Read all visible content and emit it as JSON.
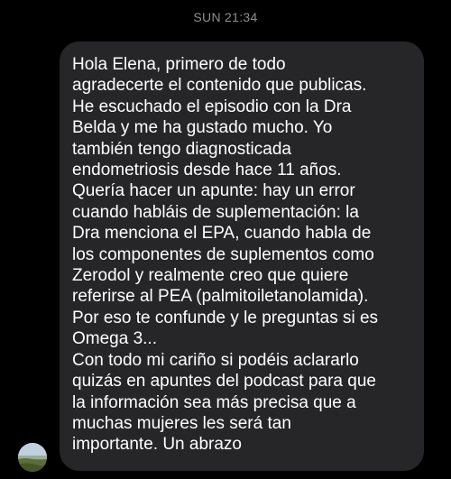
{
  "header": {
    "timestamp": "SUN 21:34"
  },
  "message": {
    "sender_avatar": "landscape-avatar",
    "lines": [
      "Hola Elena, primero de todo",
      "agradecerte el contenido que publicas.",
      "He escuchado el episodio con la Dra",
      "Belda y me ha gustado mucho. Yo",
      "también tengo diagnosticada",
      "endometriosis desde hace 11 años.",
      "Quería hacer un apunte: hay un error",
      "cuando habláis de suplementación: la",
      "Dra menciona el EPA, cuando habla de",
      "los componentes de suplementos como",
      "Zerodol y realmente creo que quiere",
      "referirse al PEA (palmitoiletanolamida).",
      "Por eso te confunde y le preguntas si es",
      "Omega 3...",
      "Con todo mi cariño si podéis aclararlo",
      "quizás en apuntes del podcast para que",
      "la información sea más precisa que a",
      "muchas mujeres les será tan",
      "importante. Un abrazo"
    ]
  },
  "colors": {
    "background": "#000000",
    "bubble": "#262628",
    "text": "#ffffff",
    "timestamp": "#8e8e93"
  }
}
